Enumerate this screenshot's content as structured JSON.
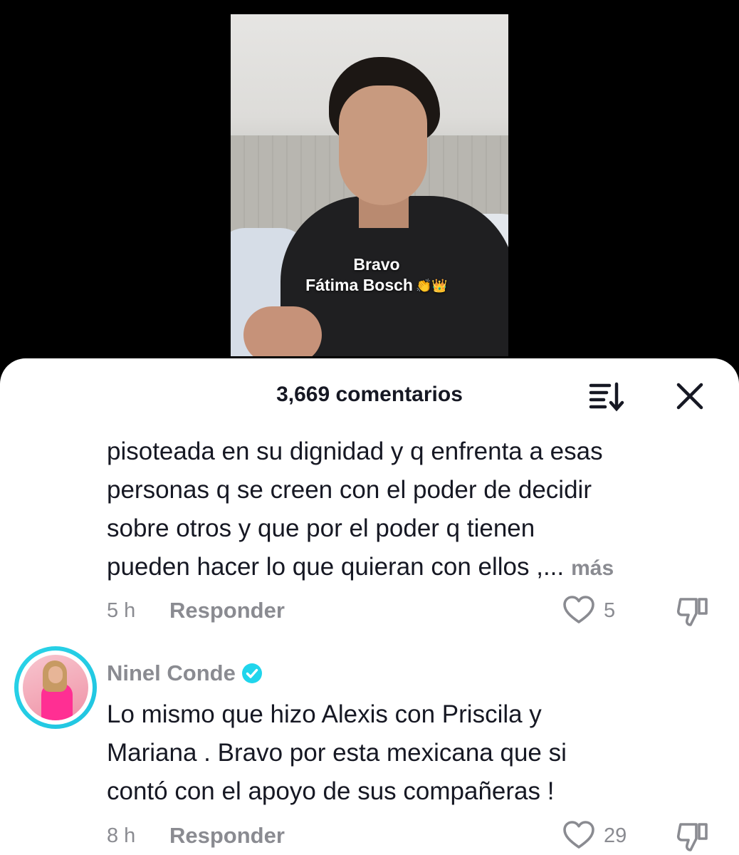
{
  "video": {
    "caption_line1": "Bravo",
    "caption_line2": "Fátima Bosch",
    "caption_emoji": "👏👑"
  },
  "comments_panel": {
    "count_label": "3,669 comentarios",
    "sort_icon": "sort-icon",
    "close_icon": "close-icon"
  },
  "comments": [
    {
      "text_lines": [
        "pisoteada en su dignidad y q enfrenta a esas",
        "personas q se creen con el poder de decidir",
        "sobre otros y que por el poder q tienen",
        "pueden hacer lo que quieran con ellos ,..."
      ],
      "more_label": "más",
      "time": "5 h",
      "reply_label": "Responder",
      "likes": "5"
    },
    {
      "username": "Ninel Conde",
      "verified": true,
      "text_lines": [
        "Lo mismo que hizo Alexis con Priscila y",
        "Mariana . Bravo por esta mexicana que si",
        "contó con el apoyo de sus compañeras !"
      ],
      "time": "8 h",
      "reply_label": "Responder",
      "likes": "29"
    }
  ],
  "colors": {
    "text_primary": "#161823",
    "text_secondary": "#8a8b91",
    "verified_blue": "#20d5ec",
    "avatar_ring": "#29d4e8"
  }
}
